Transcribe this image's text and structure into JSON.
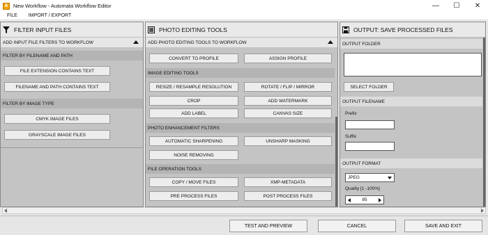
{
  "window": {
    "title": "New Workflow - Automata Workflow Editor",
    "icon_letter": "A",
    "minimize_glyph": "—",
    "maximize_glyph": "☐",
    "close_glyph": "✕"
  },
  "menu": {
    "items": [
      "FILE",
      "IMPORT / EXPORT"
    ]
  },
  "filter_panel": {
    "title": "FILTER INPUT FILES",
    "add_label": "ADD INPUT FILE FILTERS TO WORKFLOW",
    "groups": [
      {
        "label": "FILTER BY FILENAME AND PATH",
        "buttons": [
          "FILE EXTENSION CONTAINS TEXT",
          "FILENAME AND PATH CONTAINS TEXT"
        ]
      },
      {
        "label": "FILTER BY IMAGE TYPE",
        "buttons": [
          "CMYK IMAGE FILES",
          "GRAYSCALE IMAGE FILES"
        ]
      }
    ]
  },
  "photo_panel": {
    "title": "PHOTO EDITING TOOLS",
    "add_label": "ADD PHOTO EDITING TOOLS TO WORKFLOW",
    "top_buttons": [
      "CONVERT TO PROFILE",
      "ASSIGN PROFILE"
    ],
    "groups": [
      {
        "label": "IMAGE EDITING TOOLS",
        "buttons": [
          "RESIZE / RESAMPLE RESOLUTION",
          "ROTATE / FLIP / MIRROR",
          "CROP",
          "ADD WATERMARK",
          "ADD LABEL",
          "CANVAS SIZE"
        ]
      },
      {
        "label": "PHOTO ENHANCEMENT FILTERS",
        "buttons": [
          "AUTOMATIC SHARPENING",
          "UNSHARP MASKING",
          "NOISE REMOVING"
        ]
      },
      {
        "label": "FILE OPERATION TOOLS",
        "buttons": [
          "COPY / MOVE FILES",
          "XMP-METADATA",
          "PRE PROCESS FILES",
          "POST PROCESS FILES"
        ]
      }
    ]
  },
  "output_panel": {
    "title": "OUTPUT: SAVE PROCESSED FILES",
    "folder_label": "OUTPUT FOLDER",
    "select_folder": "SELECT FOLDER",
    "filename_label": "OUTPUT FILENAME",
    "prefix_label": "Prefix",
    "suffix_label": "Suffix",
    "format_label": "OUTPUT FORMAT",
    "format_value": "JPEG",
    "quality_label": "Quality [1 -100%]",
    "quality_value": "85"
  },
  "bottom": {
    "buttons": [
      "TEST AND PREVIEW",
      "CANCEL",
      "SAVE AND EXIT"
    ]
  }
}
